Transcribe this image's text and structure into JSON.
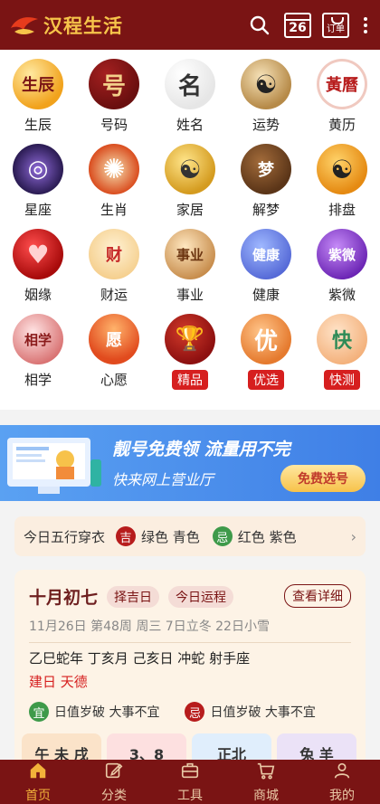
{
  "header": {
    "logo_text": "汉程生活",
    "calendar_day": "26",
    "order_label": "订单"
  },
  "grid_items": [
    {
      "label": "生辰",
      "glyph": "生辰",
      "style": "gold"
    },
    {
      "label": "号码",
      "glyph": "号",
      "style": "maroon"
    },
    {
      "label": "姓名",
      "glyph": "名",
      "style": "ink"
    },
    {
      "label": "运势",
      "glyph": "☯",
      "style": "bagua-tan"
    },
    {
      "label": "黄历",
      "glyph": "黃曆",
      "style": "white-red"
    },
    {
      "label": "星座",
      "glyph": "◎",
      "style": "galaxy"
    },
    {
      "label": "生肖",
      "glyph": "✺",
      "style": "zodiac"
    },
    {
      "label": "家居",
      "glyph": "☯",
      "style": "bagua-gold"
    },
    {
      "label": "解梦",
      "glyph": "梦",
      "style": "brown"
    },
    {
      "label": "排盘",
      "glyph": "☯",
      "style": "bagua-orange"
    },
    {
      "label": "姻缘",
      "glyph": "♥",
      "style": "hearts"
    },
    {
      "label": "财运",
      "glyph": "财",
      "style": "fortune"
    },
    {
      "label": "事业",
      "glyph": "事业",
      "style": "career"
    },
    {
      "label": "健康",
      "glyph": "健康",
      "style": "health"
    },
    {
      "label": "紫微",
      "glyph": "紫微",
      "style": "purple"
    },
    {
      "label": "相学",
      "glyph": "相学",
      "style": "face"
    },
    {
      "label": "心愿",
      "glyph": "愿",
      "style": "wish"
    },
    {
      "label": "精品",
      "glyph": "🏆",
      "style": "trophy",
      "tag": true
    },
    {
      "label": "优选",
      "glyph": "优",
      "style": "orange",
      "tag": true
    },
    {
      "label": "快测",
      "glyph": "快",
      "style": "quick",
      "tag": true
    }
  ],
  "banner": {
    "title": "靓号免费领 流量用不完",
    "subtitle": "快来网上营业厅",
    "button": "免费选号"
  },
  "wuxing": {
    "label": "今日五行穿衣",
    "good_badge": "吉",
    "good_colors": "绿色 青色",
    "bad_badge": "忌",
    "bad_colors": "红色 紫色"
  },
  "almanac": {
    "lunar_date": "十月初七",
    "pill_1": "择吉日",
    "pill_2": "今日运程",
    "detail_button": "查看详细",
    "date_line": "11月26日 第48周 周三 7日立冬 22日小雪",
    "ganzhi": "乙巳蛇年 丁亥月 己亥日 冲蛇 射手座",
    "jianri": "建日 天德",
    "yi_badge": "宜",
    "yi_text": "日值岁破 大事不宜",
    "ji_badge": "忌",
    "ji_text": "日值岁破 大事不宜",
    "chips": [
      "午 未 戌",
      "3、8",
      "正北",
      "兔 羊"
    ]
  },
  "nav": [
    {
      "label": "首页",
      "icon": "home-icon",
      "active": true
    },
    {
      "label": "分类",
      "icon": "edit-icon"
    },
    {
      "label": "工具",
      "icon": "toolbox-icon"
    },
    {
      "label": "商城",
      "icon": "cart-icon"
    },
    {
      "label": "我的",
      "icon": "user-icon"
    }
  ],
  "colors": {
    "brand": "#7a1414",
    "accent": "#f6c44a",
    "tag_red": "#d61f1f"
  }
}
